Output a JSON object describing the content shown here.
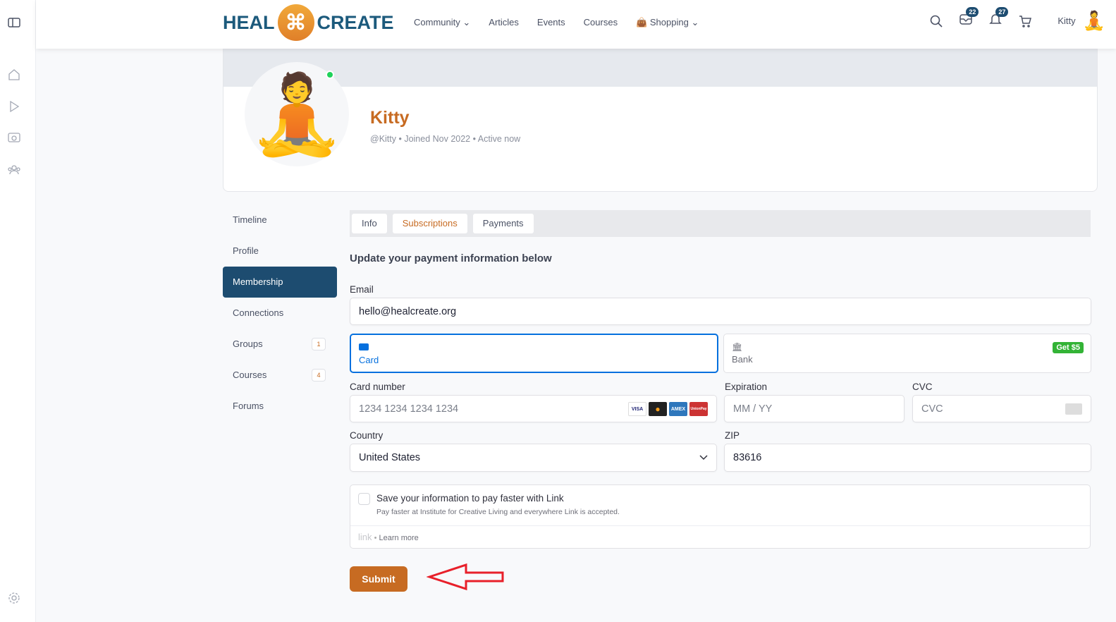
{
  "header": {
    "logo_left": "HEAL",
    "logo_right": "CREATE",
    "nav": [
      "Community",
      "Articles",
      "Events",
      "Courses",
      "Shopping"
    ],
    "messages_count": "22",
    "notifications_count": "27",
    "username": "Kitty"
  },
  "profile": {
    "name": "Kitty",
    "meta": "@Kitty • Joined Nov 2022 • Active now"
  },
  "menu": [
    {
      "label": "Timeline"
    },
    {
      "label": "Profile"
    },
    {
      "label": "Membership"
    },
    {
      "label": "Connections"
    },
    {
      "label": "Groups",
      "count": "1"
    },
    {
      "label": "Courses",
      "count": "4"
    },
    {
      "label": "Forums"
    }
  ],
  "tabs": [
    "Info",
    "Subscriptions",
    "Payments"
  ],
  "form": {
    "heading": "Update your payment information below",
    "email_label": "Email",
    "email_value": "hello@healcreate.org",
    "card_tab": "Card",
    "bank_tab": "Bank",
    "bank_promo": "Get $5",
    "card_number_label": "Card number",
    "card_number_placeholder": "1234 1234 1234 1234",
    "expiration_label": "Expiration",
    "expiration_placeholder": "MM / YY",
    "cvc_label": "CVC",
    "cvc_placeholder": "CVC",
    "country_label": "Country",
    "country_value": "United States",
    "zip_label": "ZIP",
    "zip_value": "83616",
    "link_title": "Save your information to pay faster with Link",
    "link_desc": "Pay faster at Institute for Creative Living and everywhere Link is accepted.",
    "link_logo": "link",
    "learn_more": "Learn more",
    "submit": "Submit",
    "card_brands": [
      "VISA",
      "MC",
      "AMEX",
      "UnionPay"
    ]
  },
  "colors": {
    "accent": "#c76b22",
    "primary": "#1d4c70",
    "stripe_blue": "#0570de",
    "promo": "#33b336"
  }
}
